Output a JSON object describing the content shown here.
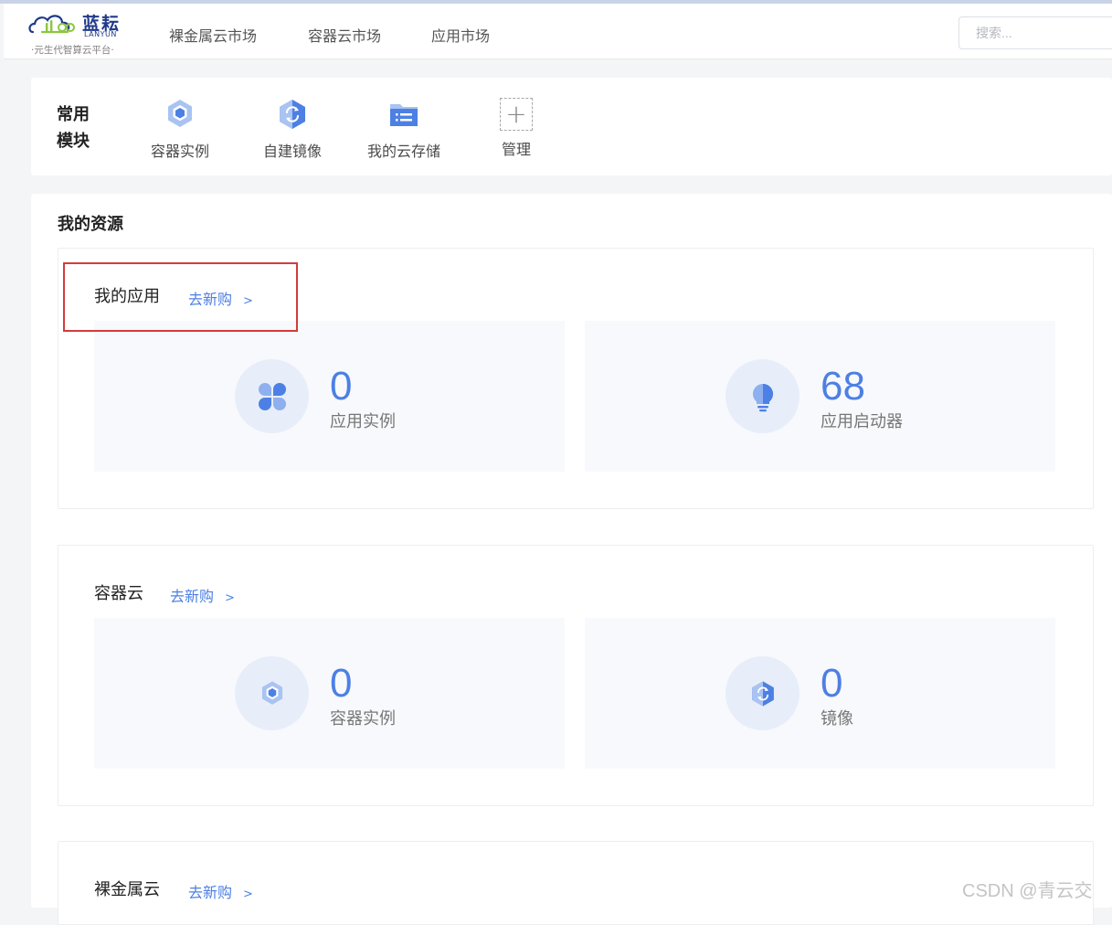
{
  "brand": {
    "name_cn": "蓝耘",
    "name_en": "LANYUN",
    "tagline": "·元生代智算云平台·"
  },
  "nav": {
    "items": [
      {
        "label": "裸金属云市场"
      },
      {
        "label": "容器云市场"
      },
      {
        "label": "应用市场"
      }
    ],
    "search_placeholder": "搜索..."
  },
  "quick_modules": {
    "title": "常用模块",
    "title_lines": [
      "常用",
      "模块"
    ],
    "items": [
      {
        "label": "容器实例",
        "icon": "container-instance-icon"
      },
      {
        "label": "自建镜像",
        "icon": "image-icon"
      },
      {
        "label": "我的云存储",
        "icon": "cloud-storage-icon"
      },
      {
        "label": "管理",
        "icon": "plus-icon"
      }
    ]
  },
  "resources": {
    "title": "我的资源",
    "groups": [
      {
        "title": "我的应用",
        "link": "去新购",
        "chevron": ">",
        "stats": [
          {
            "value": "0",
            "label": "应用实例",
            "icon": "app-grid-icon"
          },
          {
            "value": "68",
            "label": "应用启动器",
            "icon": "lightbulb-icon"
          }
        ]
      },
      {
        "title": "容器云",
        "link": "去新购",
        "chevron": ">",
        "stats": [
          {
            "value": "0",
            "label": "容器实例",
            "icon": "container-instance-icon"
          },
          {
            "value": "0",
            "label": "镜像",
            "icon": "image-icon"
          }
        ]
      },
      {
        "title": "裸金属云",
        "link": "去新购",
        "chevron": ">"
      }
    ]
  },
  "watermark": "CSDN @青云交",
  "colors": {
    "accent": "#4d80e4",
    "icon_light": "#8fb0ee",
    "highlight": "#d43b3b"
  }
}
